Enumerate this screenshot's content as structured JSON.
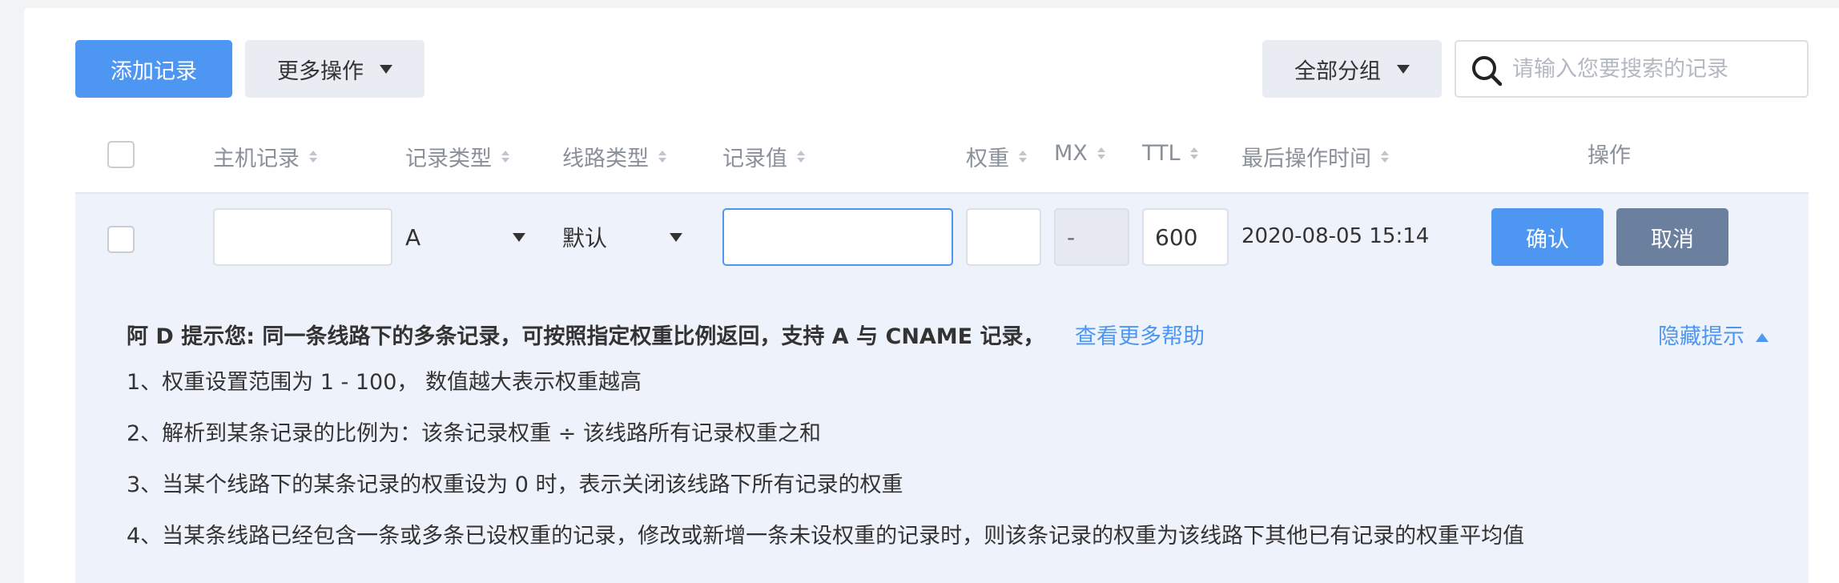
{
  "toolbar": {
    "add_record": "添加记录",
    "more_actions": "更多操作",
    "group_filter": "全部分组",
    "search_placeholder": "请输入您要搜索的记录"
  },
  "table": {
    "columns": {
      "host": "主机记录",
      "type": "记录类型",
      "line": "线路类型",
      "value": "记录值",
      "weight": "权重",
      "mx": "MX",
      "ttl": "TTL",
      "last_modified": "最后操作时间",
      "actions": "操作"
    }
  },
  "edit_row": {
    "host_value": "",
    "type_selected": "A",
    "line_selected": "默认",
    "record_value": "",
    "weight_value": "",
    "mx_value": "-",
    "ttl_value": "600",
    "last_modified": "2020-08-05 15:14",
    "confirm": "确认",
    "cancel": "取消"
  },
  "tips": {
    "title": "阿 D 提示您: 同一条线路下的多条记录，可按照指定权重比例返回，支持 A 与 CNAME 记录，",
    "more_help": "查看更多帮助",
    "hide": "隐藏提示",
    "items": [
      "1、权重设置范围为 1 - 100， 数值越大表示权重越高",
      "2、解析到某条记录的比例为：该条记录权重 ÷ 该线路所有记录权重之和",
      "3、当某个线路下的某条记录的权重设为 0 时，表示关闭该线路下所有记录的权重",
      "4、当某条线路已经包含一条或多条已设权重的记录，修改或新增一条未设权重的记录时，则该条记录的权重为该线路下其他已有记录的权重平均值"
    ]
  },
  "colors": {
    "primary": "#4d96f2",
    "cancel": "#6b7f9e",
    "panel": "#eef2fa"
  }
}
